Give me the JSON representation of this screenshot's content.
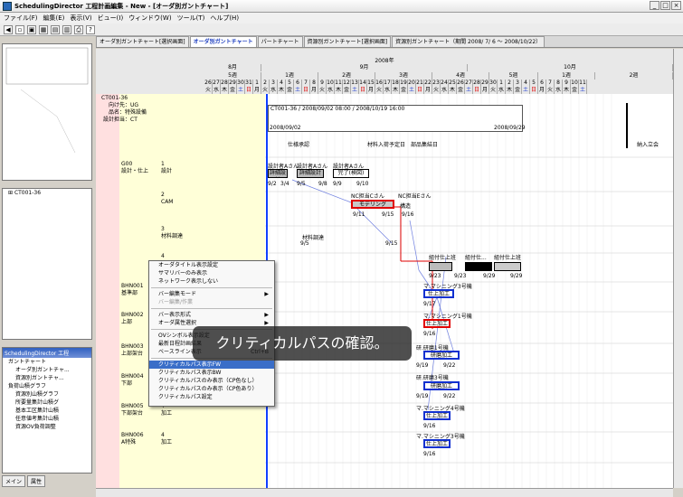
{
  "window": {
    "title": "SchedulingDirector 工程計画編集 - New - [オーダ別ガントチャート]",
    "controls": [
      "_",
      "□",
      "×"
    ]
  },
  "menu": [
    "ファイル(F)",
    "編集(E)",
    "表示(V)",
    "ビュー(I)",
    "ウィンドウ(W)",
    "ツール(T)",
    "ヘルプ(H)"
  ],
  "tabs": [
    {
      "label": "オーダ別ガントチャート[選択画面]",
      "active": false
    },
    {
      "label": "オーダ別ガントチャート",
      "active": true
    },
    {
      "label": "パートチャート",
      "active": false
    },
    {
      "label": "資源別ガントチャート[選択画面]",
      "active": false
    },
    {
      "label": "資源別ガントチャート（期間 2008/ 7/ 6 〜 2008/10/22）",
      "active": false
    }
  ],
  "timeline": {
    "year": "2008年",
    "months": [
      "8月",
      "9月",
      "10月"
    ],
    "weeks": [
      "5週",
      "1週",
      "2週",
      "3週",
      "4週",
      "5週",
      "1週",
      "2週"
    ],
    "days": [
      "26",
      "27",
      "28",
      "29",
      "30",
      "31",
      "1",
      "2",
      "3",
      "4",
      "5",
      "6",
      "7",
      "8",
      "9",
      "10",
      "11",
      "12",
      "13",
      "14",
      "15",
      "16",
      "17",
      "18",
      "19",
      "20",
      "21",
      "22",
      "23",
      "24",
      "25",
      "26",
      "27",
      "28",
      "29",
      "30",
      "1",
      "2",
      "3",
      "4",
      "5",
      "6",
      "7",
      "8",
      "9",
      "10",
      "11"
    ],
    "weekdays": [
      "火",
      "水",
      "木",
      "金",
      "土",
      "日",
      "月",
      "火",
      "水",
      "木",
      "金",
      "土",
      "日",
      "月",
      "火",
      "水",
      "木",
      "金",
      "土",
      "日",
      "月",
      "火",
      "水",
      "木",
      "金",
      "土",
      "日",
      "月",
      "火",
      "水",
      "木",
      "金",
      "土",
      "日",
      "月",
      "火",
      "水",
      "木",
      "金",
      "土",
      "日",
      "月",
      "火",
      "水",
      "木",
      "金",
      "土"
    ]
  },
  "order": {
    "id": "CT001-36",
    "customer": "向け先：UG",
    "product": "品名：特殊設備",
    "owner": "設計担当：CT",
    "bar_label": "CT001-36 / 2008/09/02 08:00 / 2008/10/19 16:00",
    "start_date": "2008/09/02",
    "end_date": "2008/09/29",
    "milestones": [
      "仕様承認",
      "材料入荷予定日",
      "部品集結日",
      "納入立会"
    ]
  },
  "rows": [
    {
      "code": "G00",
      "name": "設計・仕上",
      "step": "1",
      "stepname": "設計"
    },
    {
      "code": "",
      "name": "",
      "step": "2",
      "stepname": "CAM"
    },
    {
      "code": "",
      "name": "",
      "step": "3",
      "stepname": "材料調達"
    },
    {
      "code": "",
      "name": "",
      "step": "4",
      "stepname": ""
    },
    {
      "code": "BHN001",
      "name": "基準部",
      "step": "",
      "stepname": ""
    },
    {
      "code": "BHN002",
      "name": "上部",
      "step": "",
      "stepname": ""
    },
    {
      "code": "BHN003",
      "name": "上部架台",
      "step": "",
      "stepname": ""
    },
    {
      "code": "BHN004",
      "name": "下部",
      "step": "",
      "stepname": ""
    },
    {
      "code": "BHN005",
      "name": "下部架台",
      "step": "4",
      "stepname": "加工"
    },
    {
      "code": "BHN006",
      "name": "A特殊",
      "step": "4",
      "stepname": "加工"
    }
  ],
  "tasks": {
    "designers": [
      "設計者Aさん",
      "設計者Aさん",
      "設計者Aさん"
    ],
    "design_labels": [
      "詳細設計",
      "詳細設計",
      "完了(検図)"
    ],
    "design_dates": [
      "9/2",
      "3/4",
      "9/5",
      "9/8",
      "9/9",
      "9/10"
    ],
    "nc": [
      "NC担当Cさん",
      "NC担当Eさん"
    ],
    "nc_labels": [
      "モデリング",
      "構造"
    ],
    "nc_dates": [
      "9/11",
      "9/15",
      "9/16"
    ],
    "material": "材料調達",
    "material_dates": [
      "9/5",
      "9/15"
    ],
    "finish": [
      "組付仕上班",
      "組付仕...",
      "組付仕上班"
    ],
    "finish_dates": [
      "9/23",
      "9/23",
      "9/29",
      "9/29"
    ],
    "machining": [
      "マ.マシニング3号機",
      "マ.マシニング1号機",
      "研.研磨1号機",
      "研.研磨3号機",
      "マ.マシニング4号機",
      "マ.マシニング3号機"
    ],
    "machining_labels": [
      "仕上加工",
      "仕上加工",
      "研磨加工",
      "研磨加工",
      "仕上加工",
      "仕上加工"
    ],
    "machining_dates": [
      "9/17",
      "9/16",
      "9/19",
      "9/22",
      "9/19",
      "9/22",
      "9/16",
      "9/16"
    ]
  },
  "context_menu": [
    {
      "label": "オーダタイトル表示設定",
      "disabled": false
    },
    {
      "label": "サマリバーのみ表示",
      "disabled": false
    },
    {
      "label": "ネットワーク表示しない",
      "disabled": false
    },
    {
      "label": "バー編集モード",
      "disabled": false,
      "submenu": true
    },
    {
      "label": "バー編集/作業",
      "disabled": true
    },
    {
      "label": "バー表示形式",
      "disabled": false,
      "submenu": true
    },
    {
      "label": "オーダ属性選択",
      "disabled": false,
      "submenu": true
    },
    {
      "label": "OVシンボル表示設定",
      "disabled": false
    },
    {
      "label": "最新日程計画結果",
      "disabled": false
    },
    {
      "label": "ベースライン表示",
      "disabled": false,
      "shortcut": "Ctrl+B"
    },
    {
      "label": "クリティカルパス表示FW",
      "disabled": false,
      "highlight": true
    },
    {
      "label": "クリティカルパス表示BW",
      "disabled": false
    },
    {
      "label": "クリティカルパスのみ表示（CP色なし）",
      "disabled": false
    },
    {
      "label": "クリティカルパスのみ表示（CP色あり）",
      "disabled": false
    },
    {
      "label": "クリティカルパス設定",
      "disabled": false
    }
  ],
  "caption": "クリティカルパスの確認。",
  "left_pane": {
    "tree1_item": "CT001-36",
    "tree2_title": "SchedulingDirector 工程",
    "tree2_items": [
      "ガントチャート",
      "オーダ別ガントチャ...",
      "資源別ガントチャ...",
      "負荷山積グラフ",
      "資源別山積グラフ",
      "所要量集計山積グ",
      "基本工区集計山積",
      "任意値考集計山積",
      "資源OV負荷調整"
    ],
    "bottom_tabs": [
      "メイン",
      "属性"
    ]
  },
  "colors": {
    "accent": "#2040c0",
    "critical": "#e00000",
    "milestone_blue": "#1040ff",
    "leftcol": "#ffffd8"
  }
}
